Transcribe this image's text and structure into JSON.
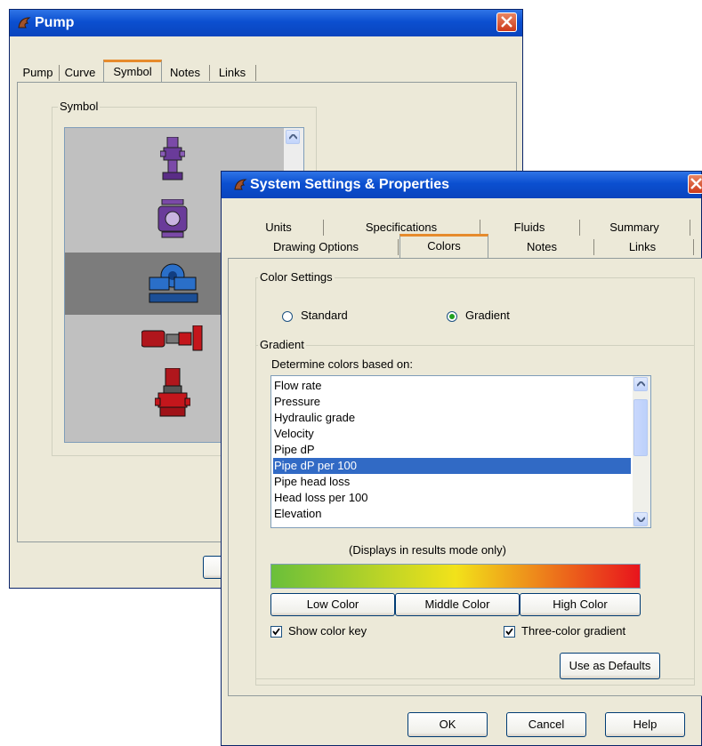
{
  "pump_window": {
    "title": "Pump",
    "tabs": [
      "Pump",
      "Curve",
      "Symbol",
      "Notes",
      "Links"
    ],
    "active_tab": "Symbol",
    "group_label": "Symbol",
    "symbols": [
      "sanitary-pump-icon",
      "diaphragm-pump-icon",
      "centrifugal-pump-icon",
      "inline-motor-pump-icon",
      "vertical-pump-icon"
    ],
    "selected_symbol": "centrifugal-pump-icon"
  },
  "settings_window": {
    "title": "System Settings & Properties",
    "tabs_back_row": [
      "Units",
      "Specifications",
      "Fluids",
      "Summary"
    ],
    "tabs_front_row": [
      "Drawing Options",
      "Colors",
      "Notes",
      "Links"
    ],
    "active_tab": "Colors",
    "color_settings": {
      "label": "Color Settings",
      "options": [
        "Standard",
        "Gradient"
      ],
      "selected": "Gradient"
    },
    "gradient": {
      "label": "Gradient",
      "prompt": "Determine colors based on:",
      "items": [
        "Flow rate",
        "Pressure",
        "Hydraulic grade",
        "Velocity",
        "Pipe dP",
        "Pipe dP per 100",
        "Pipe head loss",
        "Head loss per 100",
        "Elevation"
      ],
      "selected_item": "Pipe dP per 100",
      "note": "(Displays in results mode only)",
      "colors": {
        "low": "#6abf3a",
        "middle": "#f2e21a",
        "high": "#e8141c"
      },
      "buttons": {
        "low": "Low Color",
        "middle": "Middle Color",
        "high": "High Color"
      },
      "show_color_key": {
        "label": "Show color key",
        "checked": true
      },
      "three_color_gradient": {
        "label": "Three-color gradient",
        "checked": true
      }
    },
    "defaults_button": "Use as Defaults",
    "footer": {
      "ok": "OK",
      "cancel": "Cancel",
      "help": "Help"
    }
  }
}
